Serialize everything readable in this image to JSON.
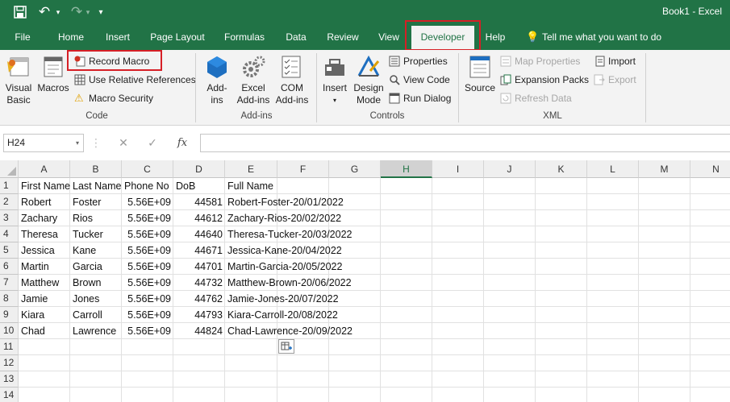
{
  "titlebar": {
    "title": "Book1  -  Excel",
    "icons": [
      "save-icon",
      "undo-icon",
      "redo-icon",
      "customize-qat-icon"
    ],
    "save_glyph": "🖫",
    "undo_glyph": "↶",
    "redo_glyph": "↷",
    "qat_glyph": "▾"
  },
  "tabs": [
    "File",
    "Home",
    "Insert",
    "Page Layout",
    "Formulas",
    "Data",
    "Review",
    "View",
    "Developer",
    "Help"
  ],
  "active_tab": "Developer",
  "tell_me": "Tell me what you want to do",
  "tell_me_glyph": "💡",
  "ribbon": {
    "code": {
      "label": "Code",
      "visual_basic_1": "Visual",
      "visual_basic_2": "Basic",
      "macros": "Macros",
      "record_macro": "Record Macro",
      "use_relative": "Use Relative References",
      "macro_security": "Macro Security",
      "warning_glyph": "⚠"
    },
    "addins": {
      "label": "Add-ins",
      "addins_1": "Add-",
      "addins_2": "ins",
      "excel_addins_1": "Excel",
      "excel_addins_2": "Add-ins",
      "com_addins_1": "COM",
      "com_addins_2": "Add-ins"
    },
    "controls": {
      "label": "Controls",
      "insert": "Insert",
      "insert_dd": "▾",
      "design_mode_1": "Design",
      "design_mode_2": "Mode",
      "properties": "Properties",
      "view_code": "View Code",
      "run_dialog": "Run Dialog"
    },
    "xml": {
      "label": "XML",
      "source": "Source",
      "map_properties": "Map Properties",
      "expansion_packs": "Expansion Packs",
      "refresh_data": "Refresh Data",
      "import": "Import",
      "export": "Export"
    }
  },
  "formula_bar": {
    "name_box": "H24",
    "name_box_dd": "▾",
    "cancel_glyph": "✕",
    "enter_glyph": "✓",
    "fx": "fx",
    "formula_value": ""
  },
  "colors": {
    "accent": "#217346",
    "highlight": "#d61f26"
  },
  "grid": {
    "selected_column": "H",
    "columns": [
      "A",
      "B",
      "C",
      "D",
      "E",
      "F",
      "G",
      "H",
      "I",
      "J",
      "K",
      "L",
      "M",
      "N"
    ],
    "row_numbers": [
      "1",
      "2",
      "3",
      "4",
      "5",
      "6",
      "7",
      "8",
      "9",
      "10",
      "11",
      "12",
      "13",
      "14"
    ],
    "headers": [
      "First Name",
      "Last Name",
      "Phone No",
      "DoB",
      "Full Name"
    ],
    "rows": [
      [
        "Robert",
        "Foster",
        "5.56E+09",
        "44581",
        "Robert-Foster-20/01/2022"
      ],
      [
        "Zachary",
        "Rios",
        "5.56E+09",
        "44612",
        "Zachary-Rios-20/02/2022"
      ],
      [
        "Theresa",
        "Tucker",
        "5.56E+09",
        "44640",
        "Theresa-Tucker-20/03/2022"
      ],
      [
        "Jessica",
        "Kane",
        "5.56E+09",
        "44671",
        "Jessica-Kane-20/04/2022"
      ],
      [
        "Martin",
        "Garcia",
        "5.56E+09",
        "44701",
        "Martin-Garcia-20/05/2022"
      ],
      [
        "Matthew",
        "Brown",
        "5.56E+09",
        "44732",
        "Matthew-Brown-20/06/2022"
      ],
      [
        "Jamie",
        "Jones",
        "5.56E+09",
        "44762",
        "Jamie-Jones-20/07/2022"
      ],
      [
        "Kiara",
        "Carroll",
        "5.56E+09",
        "44793",
        "Kiara-Carroll-20/08/2022"
      ],
      [
        "Chad",
        "Lawrence",
        "5.56E+09",
        "44824",
        "Chad-Lawrence-20/09/2022"
      ]
    ]
  }
}
